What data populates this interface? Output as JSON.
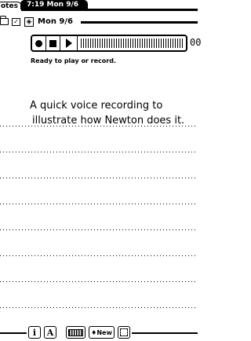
{
  "tabs": {
    "notes_label": "otes",
    "clock": "7:19 Mon 9/6"
  },
  "note_header": {
    "folder_icon": "folder-icon",
    "check_icon": "checkbox-icon",
    "stamp_icon": "stamp-icon",
    "date": "Mon 9/6"
  },
  "recorder": {
    "record_icon": "record-icon",
    "stop_icon": "stop-icon",
    "play_icon": "play-icon",
    "counter": "00",
    "status": "Ready to play or record."
  },
  "note": {
    "lines": [
      "A quick voice recording to",
      "illustrate how Newton does it."
    ]
  },
  "bottom_bar": {
    "info_label": "i",
    "styles_label": "A",
    "keyboard_icon": "keyboard-icon",
    "new_label": "♦New",
    "slots_icon": "grid-icon"
  }
}
